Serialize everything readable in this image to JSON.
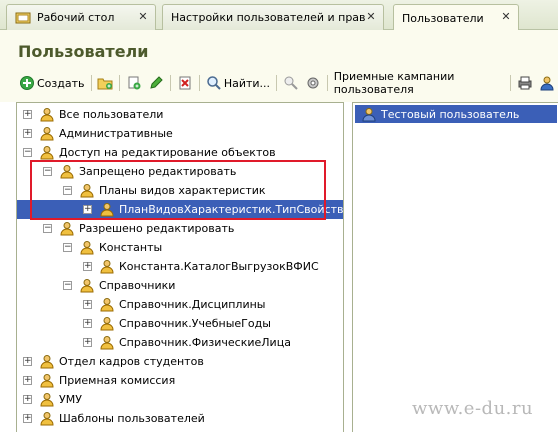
{
  "tabs": [
    {
      "label": "Рабочий стол",
      "active": false
    },
    {
      "label": "Настройки пользователей и прав",
      "active": false
    },
    {
      "label": "Пользователи",
      "active": true
    }
  ],
  "header": {
    "title": "Пользователи"
  },
  "toolbar": {
    "create_label": "Создать",
    "find_label": "Найти...",
    "campaigns_label": "Приемные кампании пользователя"
  },
  "tree": [
    {
      "label": "Все пользователи",
      "expander": "+"
    },
    {
      "label": "Административные",
      "expander": "+"
    },
    {
      "label": "Доступ на редактирование объектов",
      "expander": "-"
    },
    {
      "label": "Запрещено редактировать",
      "expander": "-"
    },
    {
      "label": "Планы видов характеристик",
      "expander": "-"
    },
    {
      "label": "ПланВидовХарактеристик.ТипСвойств",
      "expander": "+"
    },
    {
      "label": "Разрешено редактировать",
      "expander": "-"
    },
    {
      "label": "Константы",
      "expander": "-"
    },
    {
      "label": "Константа.КаталогВыгрузокВФИС",
      "expander": "+"
    },
    {
      "label": "Справочники",
      "expander": "-"
    },
    {
      "label": "Справочник.Дисциплины",
      "expander": "+"
    },
    {
      "label": "Справочник.УчебныеГоды",
      "expander": "+"
    },
    {
      "label": "Справочник.ФизическиеЛица",
      "expander": "+"
    },
    {
      "label": "Отдел кадров студентов",
      "expander": "+"
    },
    {
      "label": "Приемная комиссия",
      "expander": "+"
    },
    {
      "label": "УМУ",
      "expander": "+"
    },
    {
      "label": "Шаблоны пользователей",
      "expander": "+"
    }
  ],
  "users_list": [
    {
      "label": "Тестовый пользователь"
    }
  ],
  "watermark": "www.e-du.ru",
  "colors": {
    "selection": "#3b5fb7",
    "title": "#4d5a2c",
    "annotation": "#e01a2a"
  }
}
